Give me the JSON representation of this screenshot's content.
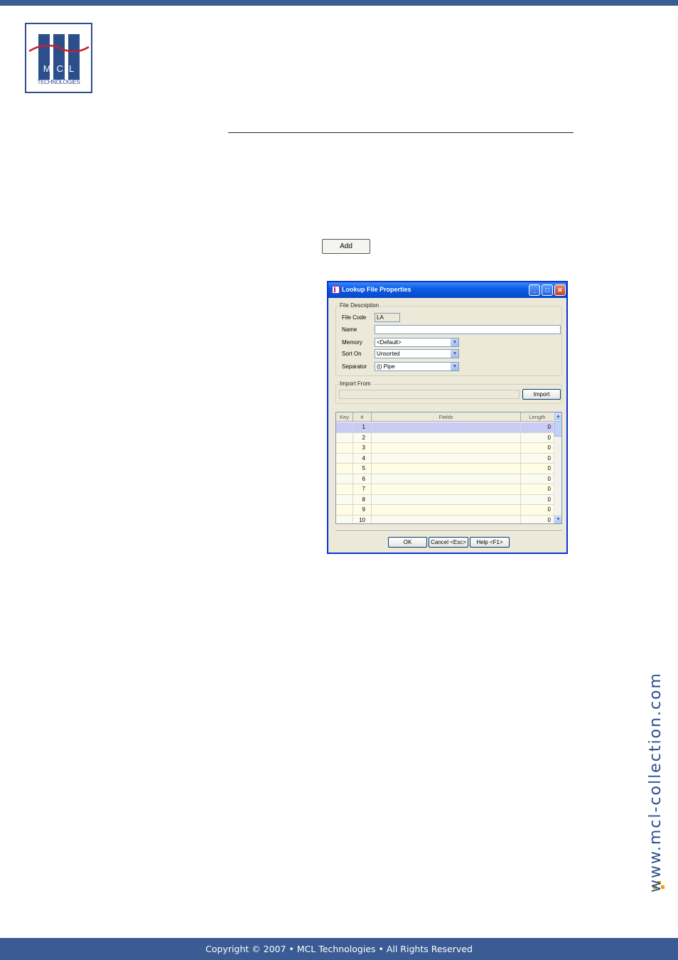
{
  "logo": {
    "letters": "MCL",
    "subtitle": "TECHNOLOGIES"
  },
  "add_button": {
    "label": "Add"
  },
  "dialog": {
    "title": "Lookup File Properties",
    "file_description": {
      "group_label": "File Description",
      "file_code_label": "File Code",
      "file_code_value": "LA",
      "name_label": "Name",
      "name_value": "",
      "memory_label": "Memory",
      "memory_value": "<Default>",
      "sort_on_label": "Sort On",
      "sort_on_value": "Unsorted",
      "separator_label": "Separator",
      "separator_value": "(|) Pipe"
    },
    "import_from": {
      "group_label": "Import From",
      "path_value": "",
      "import_button": "Import"
    },
    "grid": {
      "headers": {
        "key": "Key",
        "num": "#",
        "fields": "Fields",
        "length": "Length"
      },
      "rows": [
        {
          "num": "1",
          "field": "",
          "length": "0"
        },
        {
          "num": "2",
          "field": "",
          "length": "0"
        },
        {
          "num": "3",
          "field": "",
          "length": "0"
        },
        {
          "num": "4",
          "field": "",
          "length": "0"
        },
        {
          "num": "5",
          "field": "",
          "length": "0"
        },
        {
          "num": "6",
          "field": "",
          "length": "0"
        },
        {
          "num": "7",
          "field": "",
          "length": "0"
        },
        {
          "num": "8",
          "field": "",
          "length": "0"
        },
        {
          "num": "9",
          "field": "",
          "length": "0"
        },
        {
          "num": "10",
          "field": "",
          "length": "0"
        }
      ]
    },
    "buttons": {
      "ok": "OK",
      "cancel": "Cancel <Esc>",
      "help": "Help <F1>"
    }
  },
  "side_url": "www.mcl-collection.com",
  "footer": {
    "text": "Copyright © 2007 • MCL Technologies • All Rights Reserved"
  },
  "colors": {
    "brand_blue": "#3a5b93",
    "accent_orange": "#f0a000",
    "xp_title_blue": "#0a5de8"
  }
}
